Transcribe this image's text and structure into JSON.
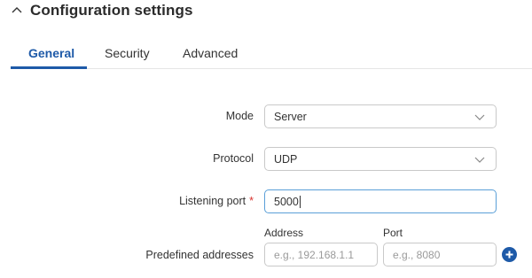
{
  "section": {
    "title": "Configuration settings",
    "chevron_icon": "chevron-up-icon"
  },
  "tabs": [
    {
      "label": "General",
      "active": true
    },
    {
      "label": "Security",
      "active": false
    },
    {
      "label": "Advanced",
      "active": false
    }
  ],
  "form": {
    "mode": {
      "label": "Mode",
      "value": "Server"
    },
    "protocol": {
      "label": "Protocol",
      "value": "UDP"
    },
    "listening_port": {
      "label": "Listening port",
      "required_mark": "*",
      "value": "5000"
    },
    "predefined_addresses": {
      "label": "Predefined addresses",
      "address_header": "Address",
      "port_header": "Port",
      "address_placeholder": "e.g., 192.168.1.1",
      "port_placeholder": "e.g., 8080",
      "add_icon": "plus-circle-icon"
    }
  },
  "colors": {
    "accent": "#1e5aa8",
    "required": "#d9322e",
    "focus_border": "#5a9fd8",
    "border": "#c9c9c9"
  }
}
